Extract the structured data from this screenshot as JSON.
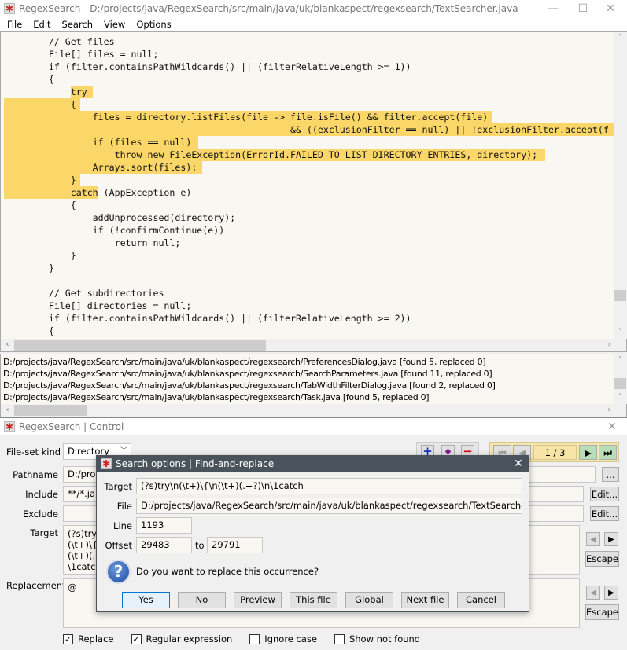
{
  "window": {
    "title": "RegexSearch - D:/projects/java/RegexSearch/src/main/java/uk/blankaspect/regexsearch/TextSearcher.java",
    "minimize": "—",
    "maximize": "☐",
    "close": "✕"
  },
  "menu": [
    "File",
    "Edit",
    "Search",
    "View",
    "Options"
  ],
  "code_lines": [
    "        // Get files",
    "        File[] files = null;",
    "        if (filter.containsPathWildcards() || (filterRelativeLength >= 1))",
    "        {",
    "            try",
    "            {",
    "                files = directory.listFiles(file -> file.isFile() && filter.accept(file)",
    "                                                    && ((exclusionFilter == null) || !exclusionFilter.accept(f",
    "                if (files == null)",
    "                    throw new FileException(ErrorId.FAILED_TO_LIST_DIRECTORY_ENTRIES, directory);",
    "                Arrays.sort(files);",
    "            }",
    "            catch (AppException e)",
    "            {",
    "                addUnprocessed(directory);",
    "                if (!confirmContinue(e))",
    "                    return null;",
    "            }",
    "        }",
    "",
    "        // Get subdirectories",
    "        File[] directories = null;",
    "        if (filter.containsPathWildcards() || (filterRelativeLength >= 2))",
    "        {"
  ],
  "results": [
    "D:/projects/java/RegexSearch/src/main/java/uk/blankaspect/regexsearch/PreferencesDialog.java  [found 5, replaced 0]",
    "D:/projects/java/RegexSearch/src/main/java/uk/blankaspect/regexsearch/SearchParameters.java  [found 11, replaced 0]",
    "D:/projects/java/RegexSearch/src/main/java/uk/blankaspect/regexsearch/TabWidthFilterDialog.java  [found 2, replaced 0]",
    "D:/projects/java/RegexSearch/src/main/java/uk/blankaspect/regexsearch/Task.java  [found 5, replaced 0]"
  ],
  "control": {
    "title": "RegexSearch | Control",
    "close": "✕",
    "file_set_kind_label": "File-set kind",
    "file_set_kind": "Directory",
    "pathname_label": "Pathname",
    "pathname": "D:/pro",
    "include_label": "Include",
    "include": "**/*.ja",
    "exclude_label": "Exclude",
    "exclude": "",
    "target_label": "Target",
    "target_lines": [
      "(?s)try",
      "(\\t+)\\{",
      "(\\t+)(.",
      "\\1catch"
    ],
    "replacement_label": "Replacement",
    "replacement": "@",
    "browse": "...",
    "edit": "Edit...",
    "escape": "Escape",
    "page": "1 / 3",
    "checkboxes": [
      {
        "label": "Replace",
        "checked": true
      },
      {
        "label": "Regular expression",
        "checked": true
      },
      {
        "label": "Ignore case",
        "checked": false
      },
      {
        "label": "Show not found",
        "checked": false
      }
    ]
  },
  "dialog": {
    "title": "Search options | Find-and-replace",
    "close": "✕",
    "target_label": "Target",
    "target": "(?s)try\\n(\\t+)\\{\\n(\\t+)(.+?)\\n\\1catch",
    "file_label": "File",
    "file": "D:/projects/java/RegexSearch/src/main/java/uk/blankaspect/regexsearch/TextSearcher.java",
    "line_label": "Line",
    "line": "1193",
    "offset_label": "Offset",
    "offset_from": "29483",
    "to_label": "to",
    "offset_to": "29791",
    "question": "Do you want to replace this occurrence?",
    "buttons": [
      "Yes",
      "No",
      "Preview",
      "This file",
      "Global",
      "Next file",
      "Cancel"
    ]
  }
}
